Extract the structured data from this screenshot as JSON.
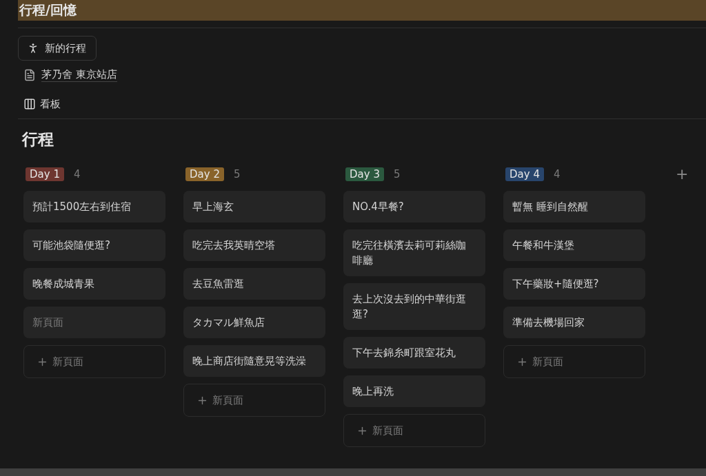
{
  "header": {
    "title": "行程/回憶"
  },
  "new_button": {
    "label": "新的行程"
  },
  "page_link": {
    "label": "茅乃舍 東京站店"
  },
  "view": {
    "label": "看板"
  },
  "board": {
    "title": "行程",
    "add_column": "+",
    "columns": [
      {
        "label": "Day 1",
        "color": "#6e3630",
        "count": "4",
        "cards": [
          {
            "kind": "page",
            "title": "預計1500左右到住宿"
          },
          {
            "kind": "page",
            "title": "可能池袋隨便逛?"
          },
          {
            "kind": "page",
            "title": "晚餐成城青果"
          },
          {
            "kind": "untitled",
            "title": "新頁面"
          }
        ],
        "new_label": "新頁面"
      },
      {
        "label": "Day 2",
        "color": "#89632a",
        "count": "5",
        "cards": [
          {
            "kind": "page",
            "title": "早上海玄"
          },
          {
            "kind": "page",
            "title": "吃完去我英晴空塔"
          },
          {
            "kind": "page",
            "title": "去豆魚雷逛"
          },
          {
            "kind": "page",
            "title": "タカマル鮮魚店"
          },
          {
            "kind": "page",
            "title": "晚上商店街隨意晃等洗澡"
          }
        ],
        "new_label": "新頁面"
      },
      {
        "label": "Day 3",
        "color": "#2b593f",
        "count": "5",
        "cards": [
          {
            "kind": "page",
            "title": "NO.4早餐?"
          },
          {
            "kind": "page",
            "title": "吃完往橫濱去莉可莉絲咖啡廳"
          },
          {
            "kind": "page",
            "title": "去上次沒去到的中華街逛逛?"
          },
          {
            "kind": "page",
            "title": "下午去錦糸町跟室花丸"
          },
          {
            "kind": "page",
            "title": "晚上再洗"
          }
        ],
        "new_label": "新頁面"
      },
      {
        "label": "Day 4",
        "color": "#28456c",
        "count": "4",
        "cards": [
          {
            "kind": "page",
            "title": "暫無 睡到自然醒"
          },
          {
            "kind": "page",
            "title": "午餐和牛漢堡"
          },
          {
            "kind": "page",
            "title": "下午藥妝+隨便逛?"
          },
          {
            "kind": "page",
            "title": "準備去機場回家"
          }
        ],
        "new_label": "新頁面"
      }
    ]
  }
}
